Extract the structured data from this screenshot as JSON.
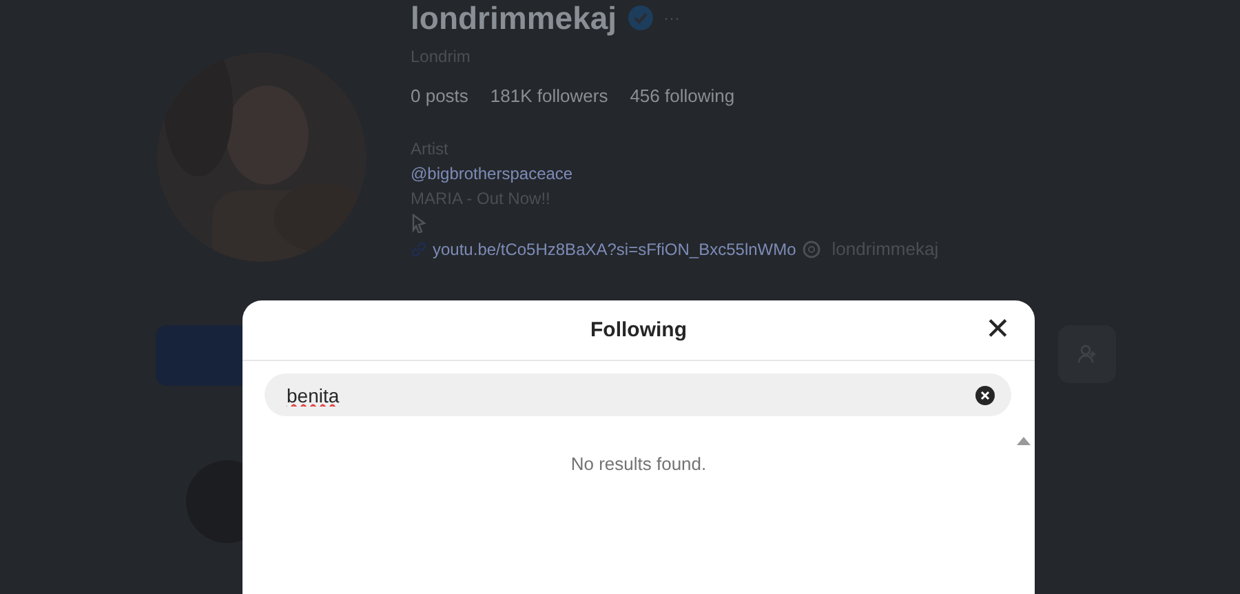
{
  "profile": {
    "username": "londrimmekaj",
    "verified": true,
    "more": "···",
    "full_name": "Londrim",
    "stats": [
      "0 posts",
      "181K followers",
      "456 following"
    ],
    "category": "Artist",
    "bio_lines": [
      "@bigbrotherspaceace",
      "MARIA - Out Now!!"
    ],
    "link": "youtu.be/tCo5Hz8BaXA?si=sFfiON_Bxc55lnWMo",
    "threads_handle": "londrimmekaj"
  },
  "modal": {
    "title": "Following",
    "close": "✕",
    "search": {
      "value": "benita"
    },
    "message": "No results found."
  }
}
